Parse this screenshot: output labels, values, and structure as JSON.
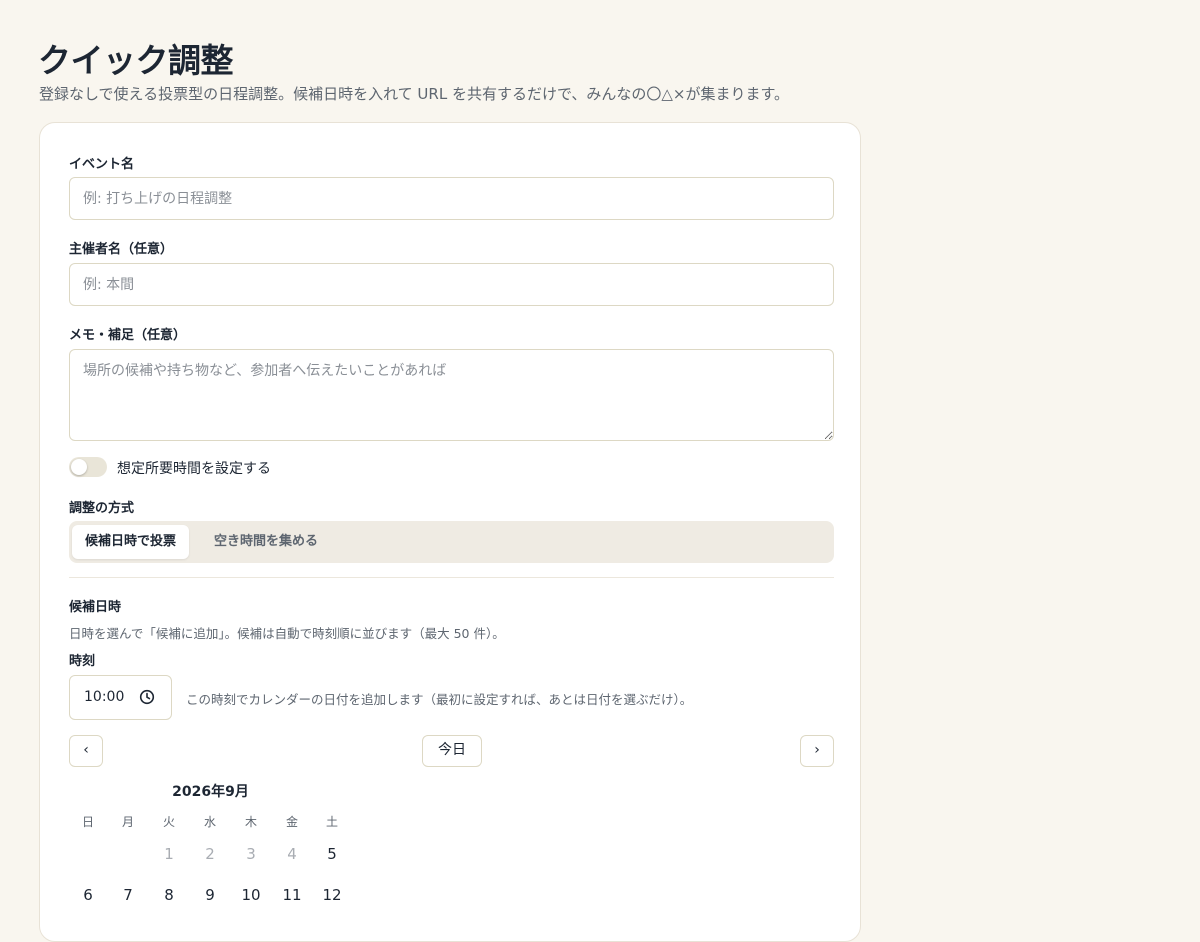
{
  "header": {
    "title": "クイック調整",
    "subtitle": "登録なしで使える投票型の日程調整。候補日時を入れて URL を共有するだけで、みんなの〇△×が集まります。"
  },
  "form": {
    "event_name": {
      "label": "イベント名",
      "placeholder": "例: 打ち上げの日程調整",
      "value": ""
    },
    "organizer": {
      "label": "主催者名（任意）",
      "placeholder": "例: 本間",
      "value": ""
    },
    "memo": {
      "label": "メモ・補足（任意）",
      "placeholder": "場所の候補や持ち物など、参加者へ伝えたいことがあれば",
      "value": ""
    },
    "duration_toggle": {
      "label": "想定所要時間を設定する",
      "on": false
    },
    "method": {
      "label": "調整の方式",
      "options": [
        "候補日時で投票",
        "空き時間を集める"
      ],
      "selected": "候補日時で投票"
    },
    "candidates": {
      "label": "候補日時",
      "help": "日時を選んで「候補に追加」。候補は自動で時刻順に並びます（最大 50 件）。"
    },
    "time": {
      "label": "時刻",
      "value": "10:00",
      "help": "この時刻でカレンダーの日付を追加します（最初に設定すれば、あとは日付を選ぶだけ）。"
    }
  },
  "calendar": {
    "prev": "‹",
    "today": "今日",
    "next": "›",
    "month_title": "2026年9月",
    "weekdays": [
      "日",
      "月",
      "火",
      "水",
      "木",
      "金",
      "土"
    ],
    "week1": [
      "",
      "",
      "1",
      "2",
      "3",
      "4",
      "5"
    ],
    "week2": [
      "6",
      "7",
      "8",
      "9",
      "10",
      "11",
      "12"
    ]
  }
}
